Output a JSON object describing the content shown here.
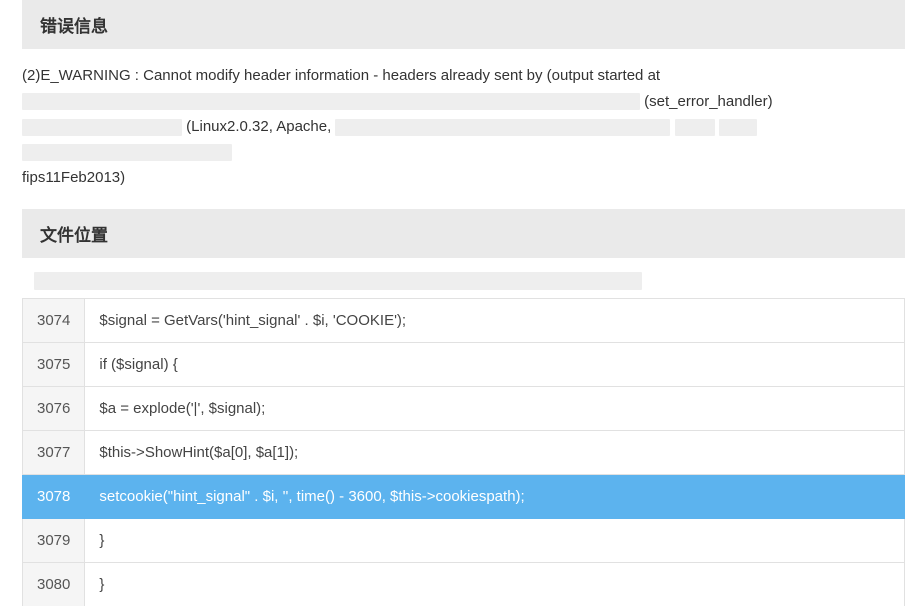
{
  "sections": {
    "error_header": "错误信息",
    "file_header": "文件位置"
  },
  "error": {
    "prefix": "(2)E_WARNING : Cannot modify header information - headers already sent by (output started at",
    "handler": " (set_error_handler)",
    "apache_fragment": " (Linux2.0.32, Apache,",
    "fips": "fips11Feb2013)"
  },
  "code": {
    "lines": [
      {
        "n": "3074",
        "c": "$signal = GetVars('hint_signal' . $i, 'COOKIE');",
        "hl": false
      },
      {
        "n": "3075",
        "c": "if ($signal) {",
        "hl": false
      },
      {
        "n": "3076",
        "c": "$a = explode('|', $signal);",
        "hl": false
      },
      {
        "n": "3077",
        "c": "$this->ShowHint($a[0], $a[1]);",
        "hl": false
      },
      {
        "n": "3078",
        "c": "setcookie(\"hint_signal\" . $i, '', time() - 3600, $this->cookiespath);",
        "hl": true
      },
      {
        "n": "3079",
        "c": "}",
        "hl": false
      },
      {
        "n": "3080",
        "c": "}",
        "hl": false
      }
    ]
  }
}
